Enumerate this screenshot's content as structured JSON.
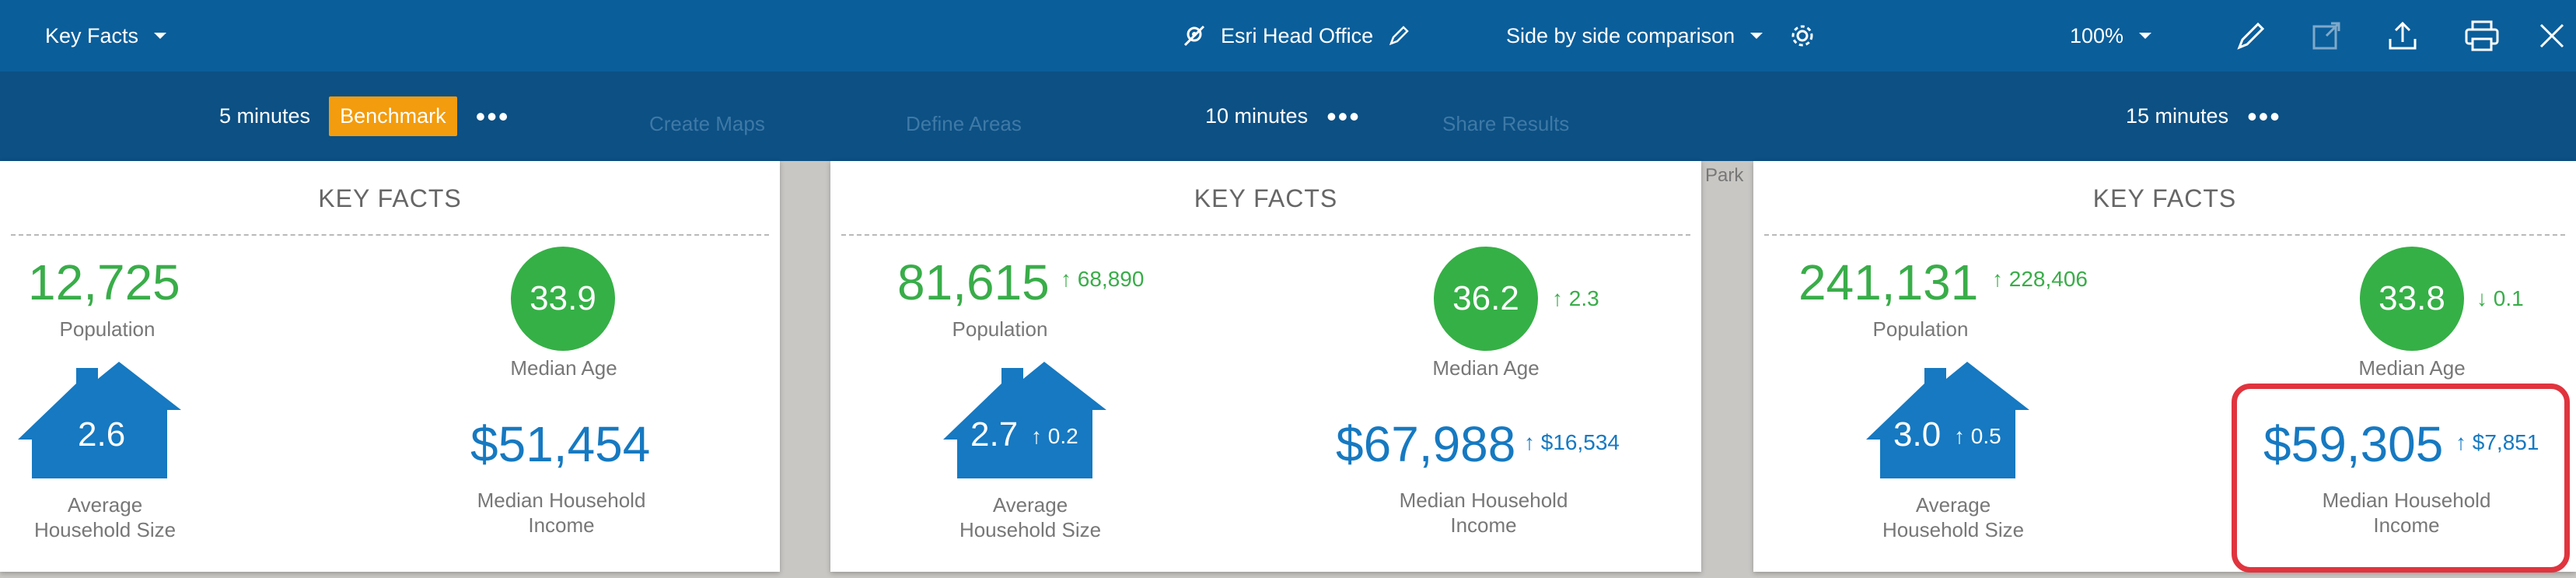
{
  "toolbar": {
    "infographic_select": "Key Facts",
    "site_name": "Esri Head Office",
    "comparison_mode": "Side by side comparison",
    "zoom": "100%"
  },
  "background_nav": {
    "items": [
      "Create Maps",
      "Define Areas",
      "Share Results"
    ]
  },
  "columns": [
    {
      "header": "5 minutes",
      "badge": "Benchmark",
      "title": "KEY FACTS",
      "population": "12,725",
      "population_label": "Population",
      "median_age": "33.9",
      "median_age_label": "Median Age",
      "household_size": "2.6",
      "household_size_label_line1": "Average",
      "household_size_label_line2": "Household Size",
      "income": "$51,454",
      "income_label_line1": "Median Household",
      "income_label_line2": "Income"
    },
    {
      "header": "10 minutes",
      "title": "KEY FACTS",
      "population": "81,615",
      "population_delta": "↑ 68,890",
      "population_label": "Population",
      "median_age": "36.2",
      "median_age_delta": "↑ 2.3",
      "median_age_label": "Median Age",
      "household_size": "2.7",
      "household_size_delta": "↑ 0.2",
      "household_size_label_line1": "Average",
      "household_size_label_line2": "Household Size",
      "income": "$67,988",
      "income_delta": "↑ $16,534",
      "income_label_line1": "Median Household",
      "income_label_line2": "Income"
    },
    {
      "header": "15 minutes",
      "title": "KEY FACTS",
      "population": "241,131",
      "population_delta": "↑ 228,406",
      "population_label": "Population",
      "median_age": "33.8",
      "median_age_delta": "↓ 0.1",
      "median_age_label": "Median Age",
      "household_size": "3.0",
      "household_size_delta": "↑ 0.5",
      "household_size_label_line1": "Average",
      "household_size_label_line2": "Household Size",
      "income": "$59,305",
      "income_delta": "↑ $7,851",
      "income_label_line1": "Median Household",
      "income_label_line2": "Income"
    }
  ],
  "map_labels": [
    "Park"
  ],
  "colors": {
    "toolbar_bg": "#0a5e9a",
    "subbar_bg": "#0c5084",
    "benchmark_badge": "#f39c0d",
    "green": "#39ad49",
    "blue": "#1679c1",
    "highlight": "#e0343e"
  },
  "icons": [
    "chevron-down-icon",
    "pin-icon",
    "pencil-icon",
    "gear-icon",
    "edit-icon",
    "export-icon",
    "share-icon",
    "print-icon",
    "close-icon",
    "more-icon",
    "house-icon"
  ]
}
